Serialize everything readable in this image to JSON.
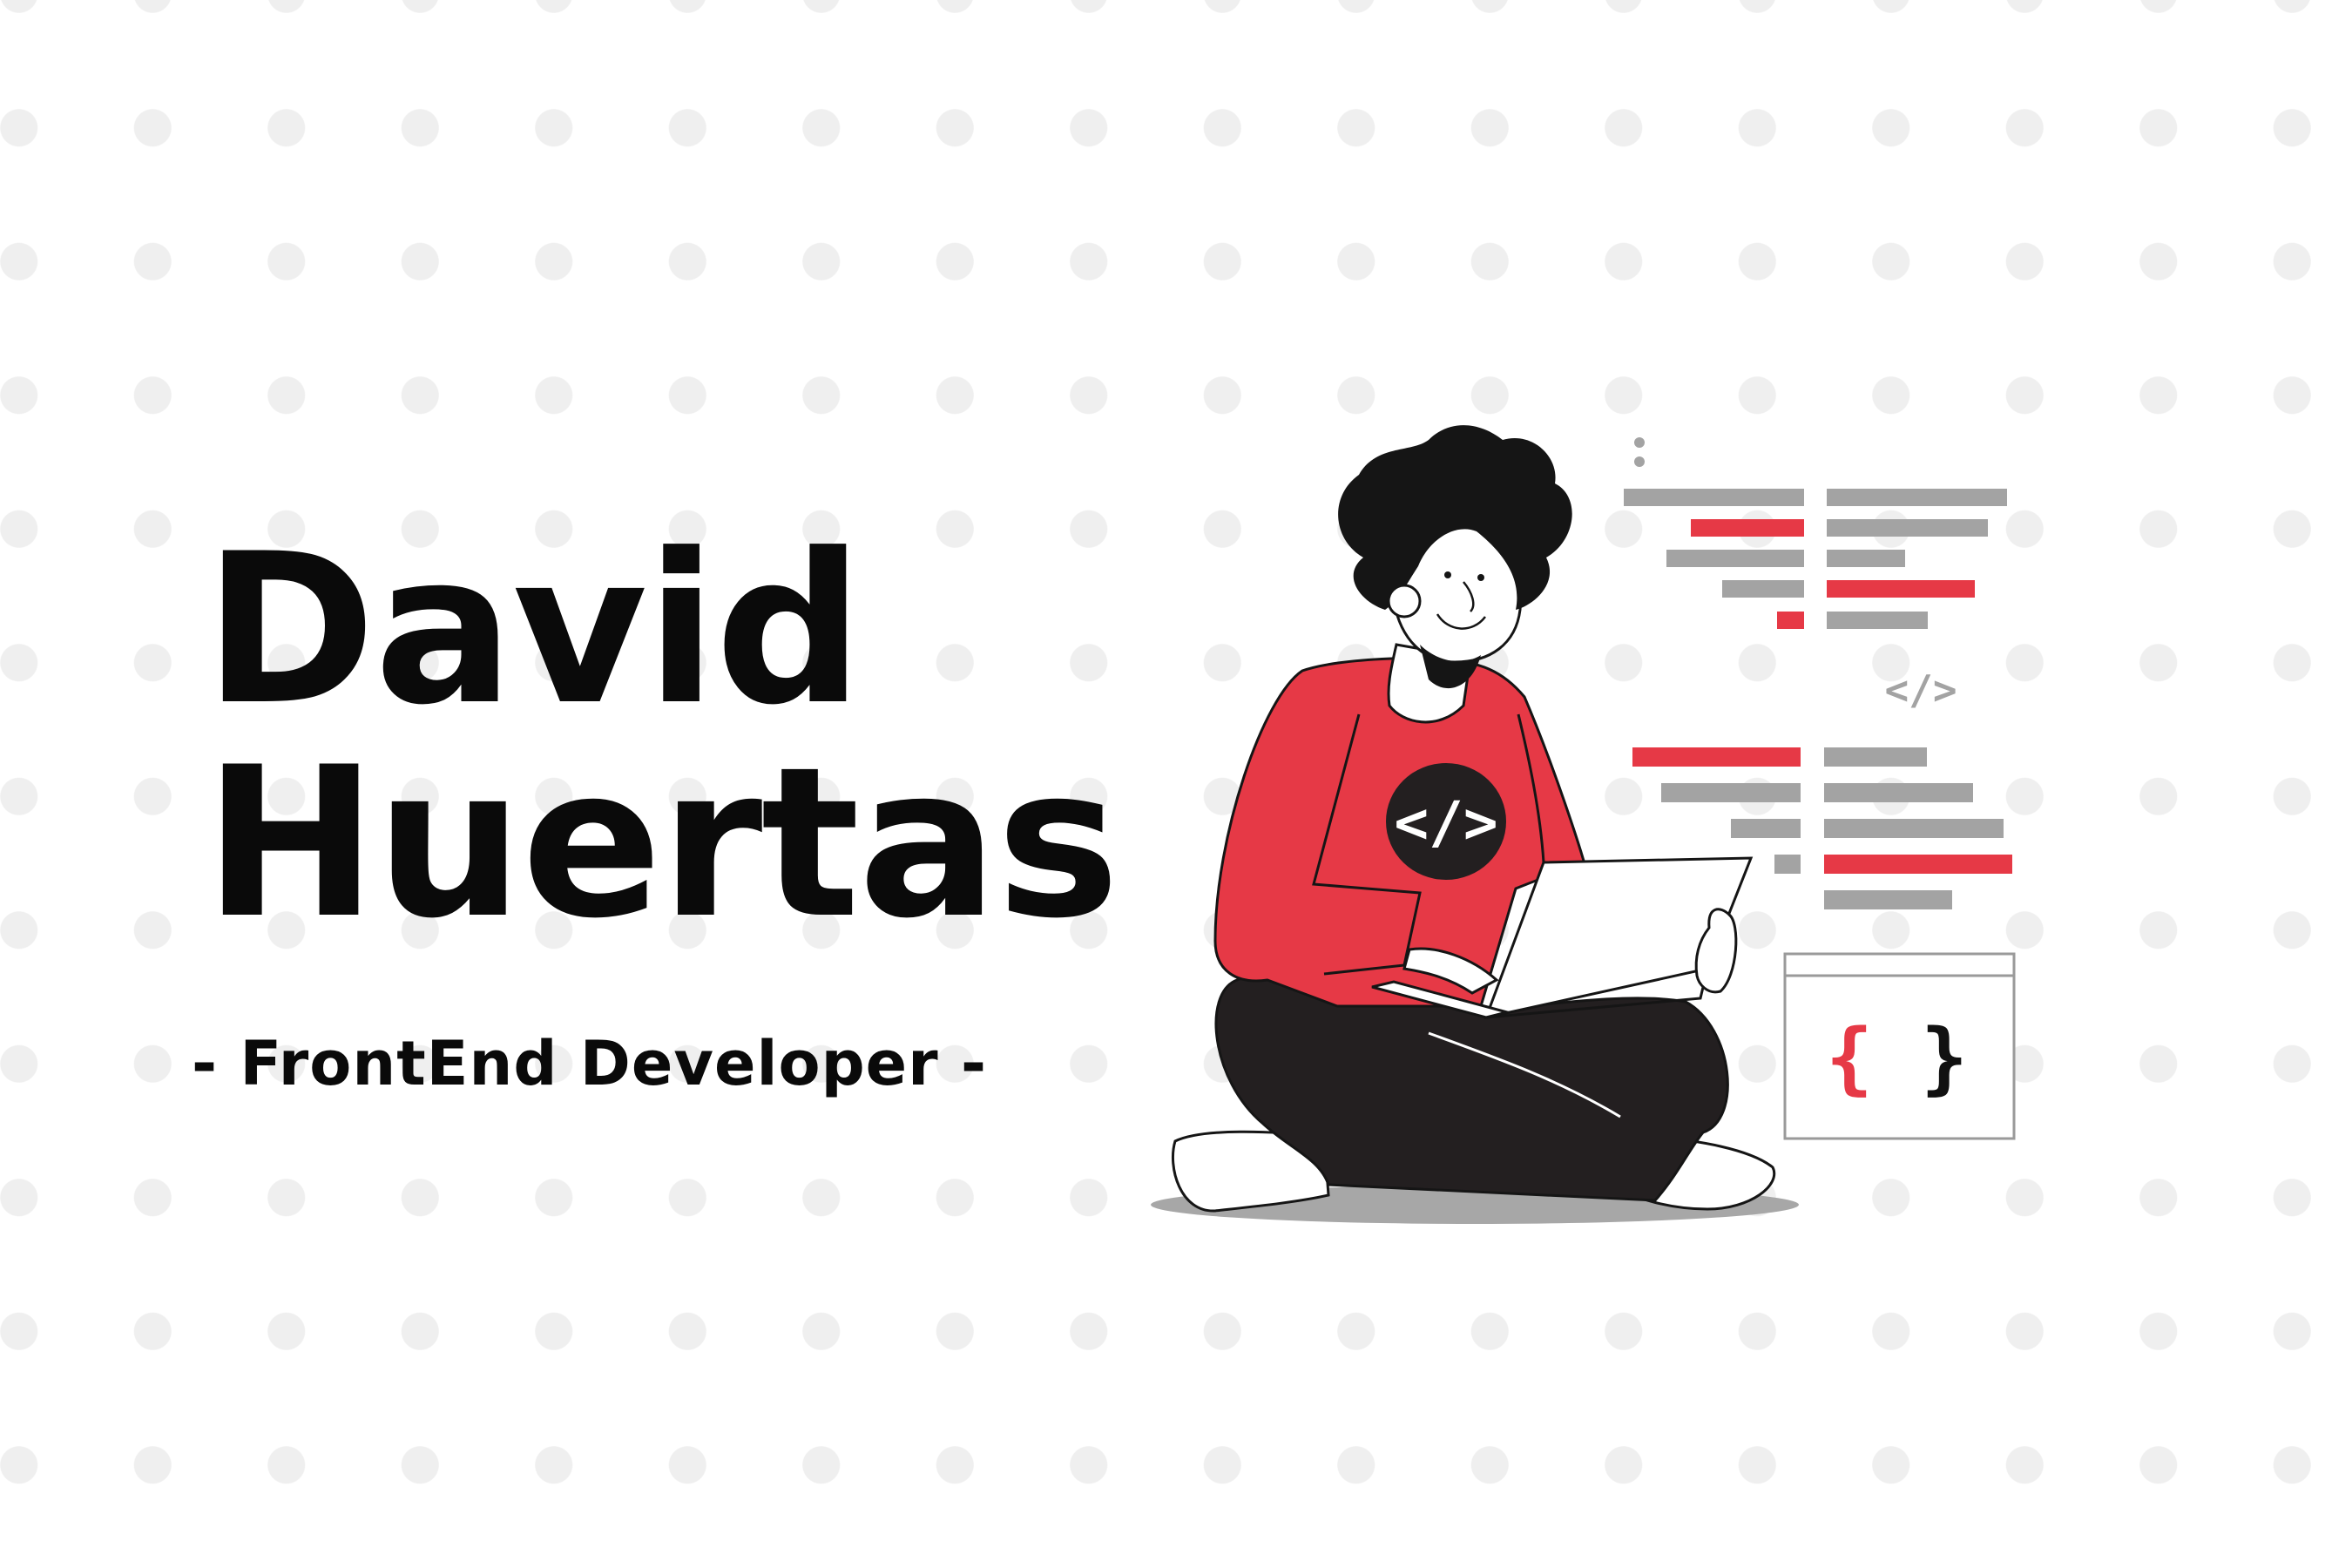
{
  "profile": {
    "first_name": "David",
    "last_name": "Huertas",
    "role": "- FrontEnd Developer -"
  },
  "illustration": {
    "subject": "developer sitting cross-legged with laptop",
    "shirt_glyph": "</>",
    "code_tag": "</>",
    "brace_open": "{",
    "brace_close": "}"
  },
  "colors": {
    "accent_red": "#e63946",
    "text_dark": "#0a0a0a",
    "code_gray": "#a3a3a3",
    "dot_gray": "#efefef"
  }
}
